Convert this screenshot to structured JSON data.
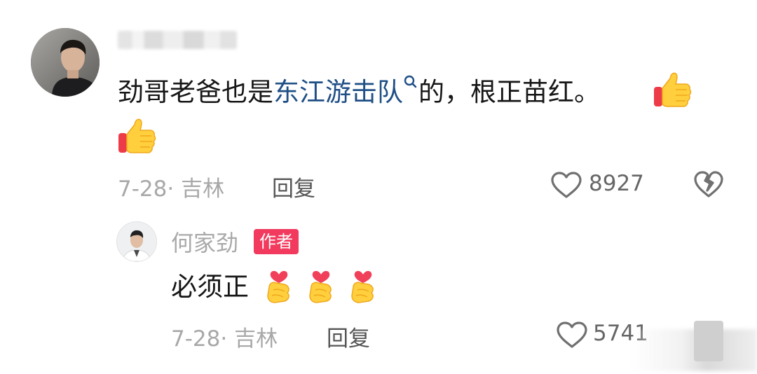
{
  "comment": {
    "text_before_link": "劲哥老爸也是",
    "link_text": "东江游击队",
    "text_after_link": "的，根正苗红。",
    "date_location": "7-28· 吉林",
    "reply_label": "回复",
    "like_count": "8927",
    "icons": [
      "search-icon",
      "thumbs-up-emoji",
      "heart-outline-icon",
      "dislike-broken-heart-icon"
    ]
  },
  "reply": {
    "author": "何家劲",
    "badge": "作者",
    "text": "必须正",
    "date_location": "7-28· 吉林",
    "reply_label": "回复",
    "like_count": "5741",
    "icons": [
      "finger-heart-emoji",
      "heart-outline-icon"
    ]
  },
  "colors": {
    "link": "#1f4f86",
    "badge_bg": "#f23a5e",
    "meta_text": "#a8a8a8"
  }
}
